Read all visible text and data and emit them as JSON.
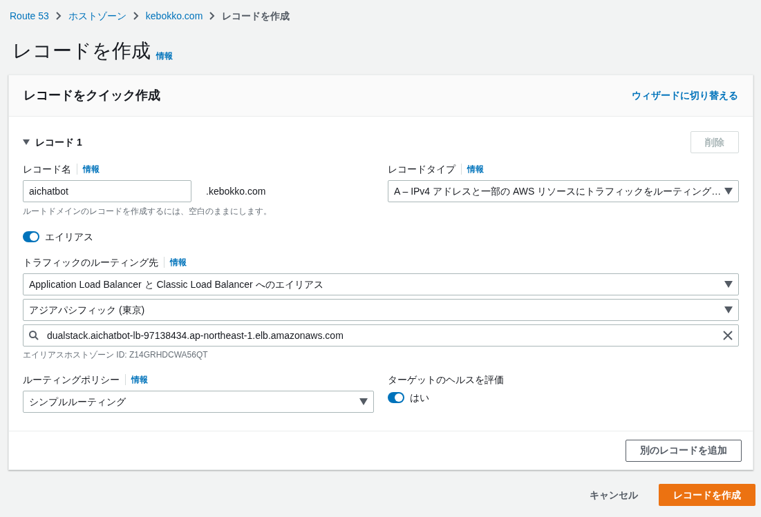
{
  "breadcrumb": [
    {
      "label": "Route 53",
      "link": true
    },
    {
      "label": "ホストゾーン",
      "link": true
    },
    {
      "label": "kebokko.com",
      "link": true
    },
    {
      "label": "レコードを作成",
      "link": false
    }
  ],
  "page_title": "レコードを作成",
  "page_info": "情報",
  "card": {
    "title": "レコードをクイック作成",
    "switch_link": "ウィザードに切り替える",
    "record": {
      "title": "レコード 1",
      "expanded": true,
      "delete_button": {
        "label": "削除",
        "disabled": true
      },
      "record_name": {
        "label": "レコード名",
        "info": "情報",
        "value": "aichatbot",
        "suffix": ".kebokko.com",
        "hint": "ルートドメインのレコードを作成するには、空白のままにします。"
      },
      "record_type": {
        "label": "レコードタイプ",
        "info": "情報",
        "value": "A – IPv4 アドレスと一部の AWS リソースにトラフィックをルーティング…"
      },
      "alias": {
        "label": "エイリアス",
        "on": true
      },
      "route_target": {
        "label": "トラフィックのルーティング先",
        "info": "情報",
        "endpoint": "Application Load Balancer と Classic Load Balancer へのエイリアス",
        "region": "アジアパシフィック (東京)",
        "search_value": "dualstack.aichatbot-lb-97138434.ap-northeast-1.elb.amazonaws.com",
        "hint": "エイリアスホストゾーン ID: Z14GRHDCWA56QT"
      },
      "routing_policy": {
        "label": "ルーティングポリシー",
        "info": "情報",
        "value": "シンプルルーティング"
      },
      "evaluate_health": {
        "label": "ターゲットのヘルスを評価",
        "value_label": "はい",
        "on": true
      }
    },
    "add_button": "別のレコードを追加"
  },
  "footer_buttons": {
    "cancel": "キャンセル",
    "create": "レコードを作成"
  }
}
